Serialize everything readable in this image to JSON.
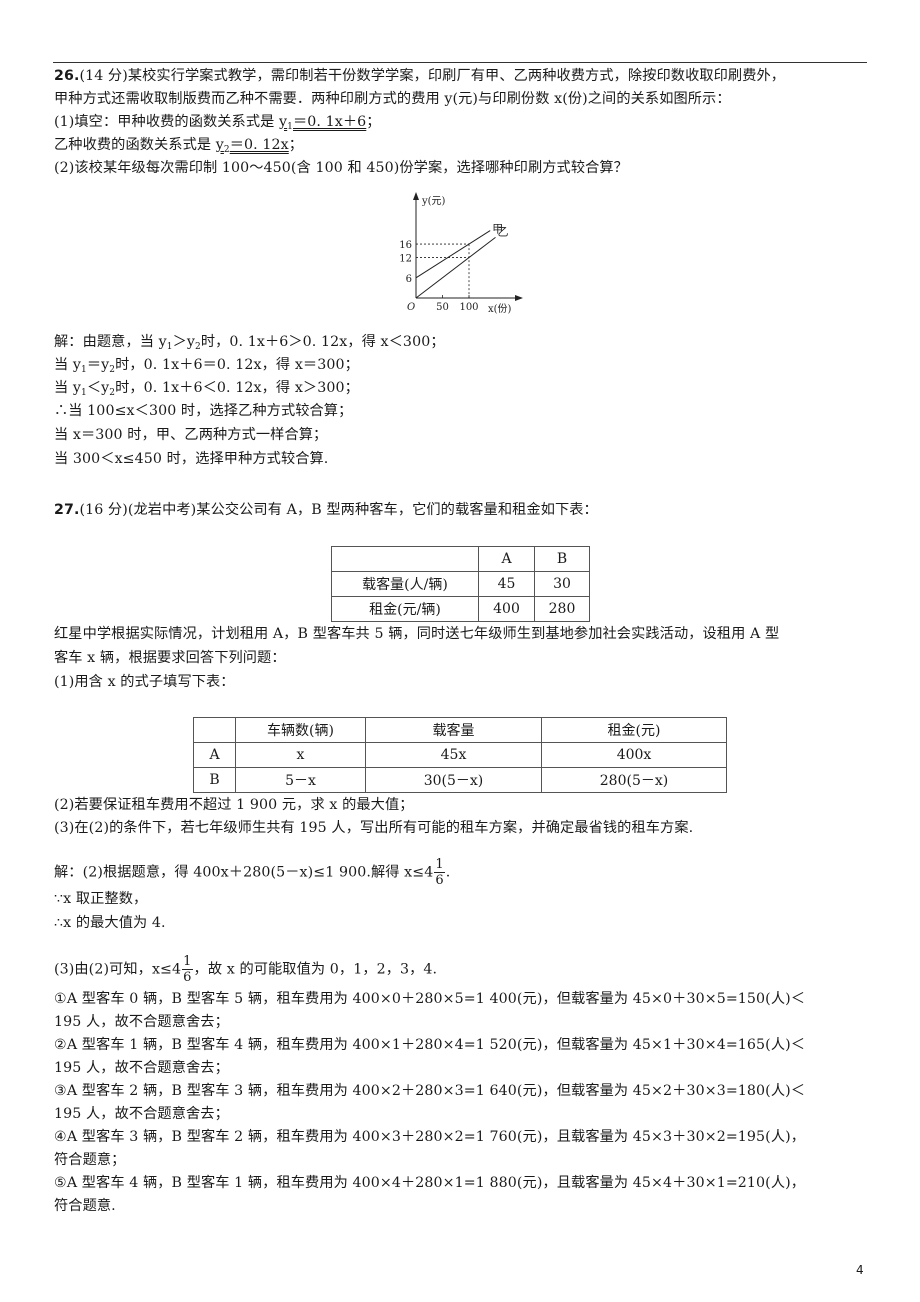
{
  "page_number": "4",
  "q26": {
    "number": "26.",
    "line1": "(14 分)某校实行学案式教学，需印制若干份数学学案，印刷厂有甲、乙两种收费方式，除按印数收取印刷费外，",
    "line2": "甲种方式还需收取制版费而乙种不需要．两种印刷方式的费用 y(元)与印刷份数 x(份)之间的关系如图所示：",
    "p1_prefix": "(1)填空：甲种收费的函数关系式是 ",
    "p1_ans_y": "y",
    "p1_ans_sub": "1",
    "p1_ans_rest": "＝0. 1x＋6",
    "p1_suffix": "；",
    "p2_prefix": "乙种收费的函数关系式是 ",
    "p2_ans_y": "y",
    "p2_ans_sub": "2",
    "p2_ans_rest": "＝0. 12x",
    "p2_suffix": "；",
    "p3": "(2)该校某年级每次需印制 100～450(含 100 和 450)份学案，选择哪种印刷方式较合算？",
    "solution": [
      {
        "pre": "解：由题意，当 y",
        "s1": "1",
        "mid": "＞y",
        "s2": "2",
        "post": "时，0. 1x＋6＞0. 12x，得 x＜300；"
      },
      {
        "pre": "当 y",
        "s1": "1",
        "mid": "＝y",
        "s2": "2",
        "post": "时，0. 1x＋6＝0. 12x，得 x＝300；"
      },
      {
        "pre": "当 y",
        "s1": "1",
        "mid": "＜y",
        "s2": "2",
        "post": "时，0. 1x＋6＜0. 12x，得 x＞300；"
      }
    ],
    "solution_tail": [
      "∴当 100≤x＜300 时，选择乙种方式较合算；",
      "当 x＝300 时，甲、乙两种方式一样合算；",
      "当 300＜x≤450 时，选择甲种方式较合算."
    ]
  },
  "chart_data": {
    "type": "line",
    "title": "",
    "xlabel": "x(份)",
    "ylabel": "y(元)",
    "origin_label": "O",
    "x_ticks": [
      50,
      100
    ],
    "y_ticks": [
      6,
      12,
      16
    ],
    "xlim": [
      0,
      150
    ],
    "ylim": [
      0,
      22
    ],
    "grid": false,
    "guides": [
      {
        "x": 100,
        "y": 16
      },
      {
        "x": 100,
        "y": 12
      }
    ],
    "series": [
      {
        "name": "甲",
        "points": [
          [
            0,
            6
          ],
          [
            140,
            20
          ]
        ]
      },
      {
        "name": "乙",
        "points": [
          [
            0,
            0
          ],
          [
            150,
            18
          ]
        ]
      }
    ]
  },
  "q27": {
    "number": "27.",
    "line1": "(16 分)(龙岩中考)某公交公司有 A，B 型两种客车，它们的载客量和租金如下表：",
    "table1": {
      "header": [
        "",
        "A",
        "B"
      ],
      "rows": [
        [
          "载客量(人/辆)",
          "45",
          "30"
        ],
        [
          "租金(元/辆)",
          "400",
          "280"
        ]
      ]
    },
    "line2": "红星中学根据实际情况，计划租用 A，B 型客车共 5 辆，同时送七年级师生到基地参加社会实践活动，设租用 A 型",
    "line3": "客车 x 辆，根据要求回答下列问题：",
    "line4": "(1)用含 x 的式子填写下表：",
    "table2": {
      "header": [
        "",
        "车辆数(辆)",
        "载客量",
        "租金(元)"
      ],
      "rows": [
        [
          "A",
          "x",
          "45x",
          "400x"
        ],
        [
          "B",
          "5－x",
          "30(5－x)",
          "280(5－x)"
        ]
      ]
    },
    "line5": "(2)若要保证租车费用不超过 1  900 元，求 x 的最大值；",
    "line6": "(3)在(2)的条件下，若七年级师生共有 195 人，写出所有可能的租车方案，并确定最省钱的租车方案.",
    "sol1_pre": "解：(2)根据题意，得 400x＋280(5－x)≤1  900.解得 x≤4",
    "frac_num": "1",
    "frac_den": "6",
    "sol1_post": ".",
    "sol2": "∵x 取正整数，",
    "sol3": "∴x 的最大值为 4.",
    "sol4_pre": "(3)由(2)可知，x≤4",
    "sol4_post": "，故 x 的可能取值为 0，1，2，3，4.",
    "cases": [
      "①A 型客车 0 辆，B 型客车 5 辆，租车费用为 400×0＋280×5=1  400(元)，但载客量为 45×0＋30×5=150(人)＜",
      "195 人，故不合题意舍去；",
      "②A 型客车 1 辆，B 型客车 4 辆，租车费用为 400×1＋280×4=1  520(元)，但载客量为 45×1＋30×4=165(人)＜",
      "195 人，故不合题意舍去；",
      "③A 型客车 2 辆，B 型客车 3 辆，租车费用为 400×2＋280×3=1  640(元)，但载客量为 45×2＋30×3=180(人)＜",
      "195 人，故不合题意舍去；",
      "④A 型客车 3 辆，B 型客车 2 辆，租车费用为 400×3＋280×2=1  760(元)，且载客量为 45×3＋30×2=195(人)，",
      "符合题意；",
      "⑤A 型客车 4 辆，B 型客车 1 辆，租车费用为 400×4＋280×1=1  880(元)，且载客量为 45×4＋30×1=210(人)，",
      "符合题意."
    ]
  }
}
